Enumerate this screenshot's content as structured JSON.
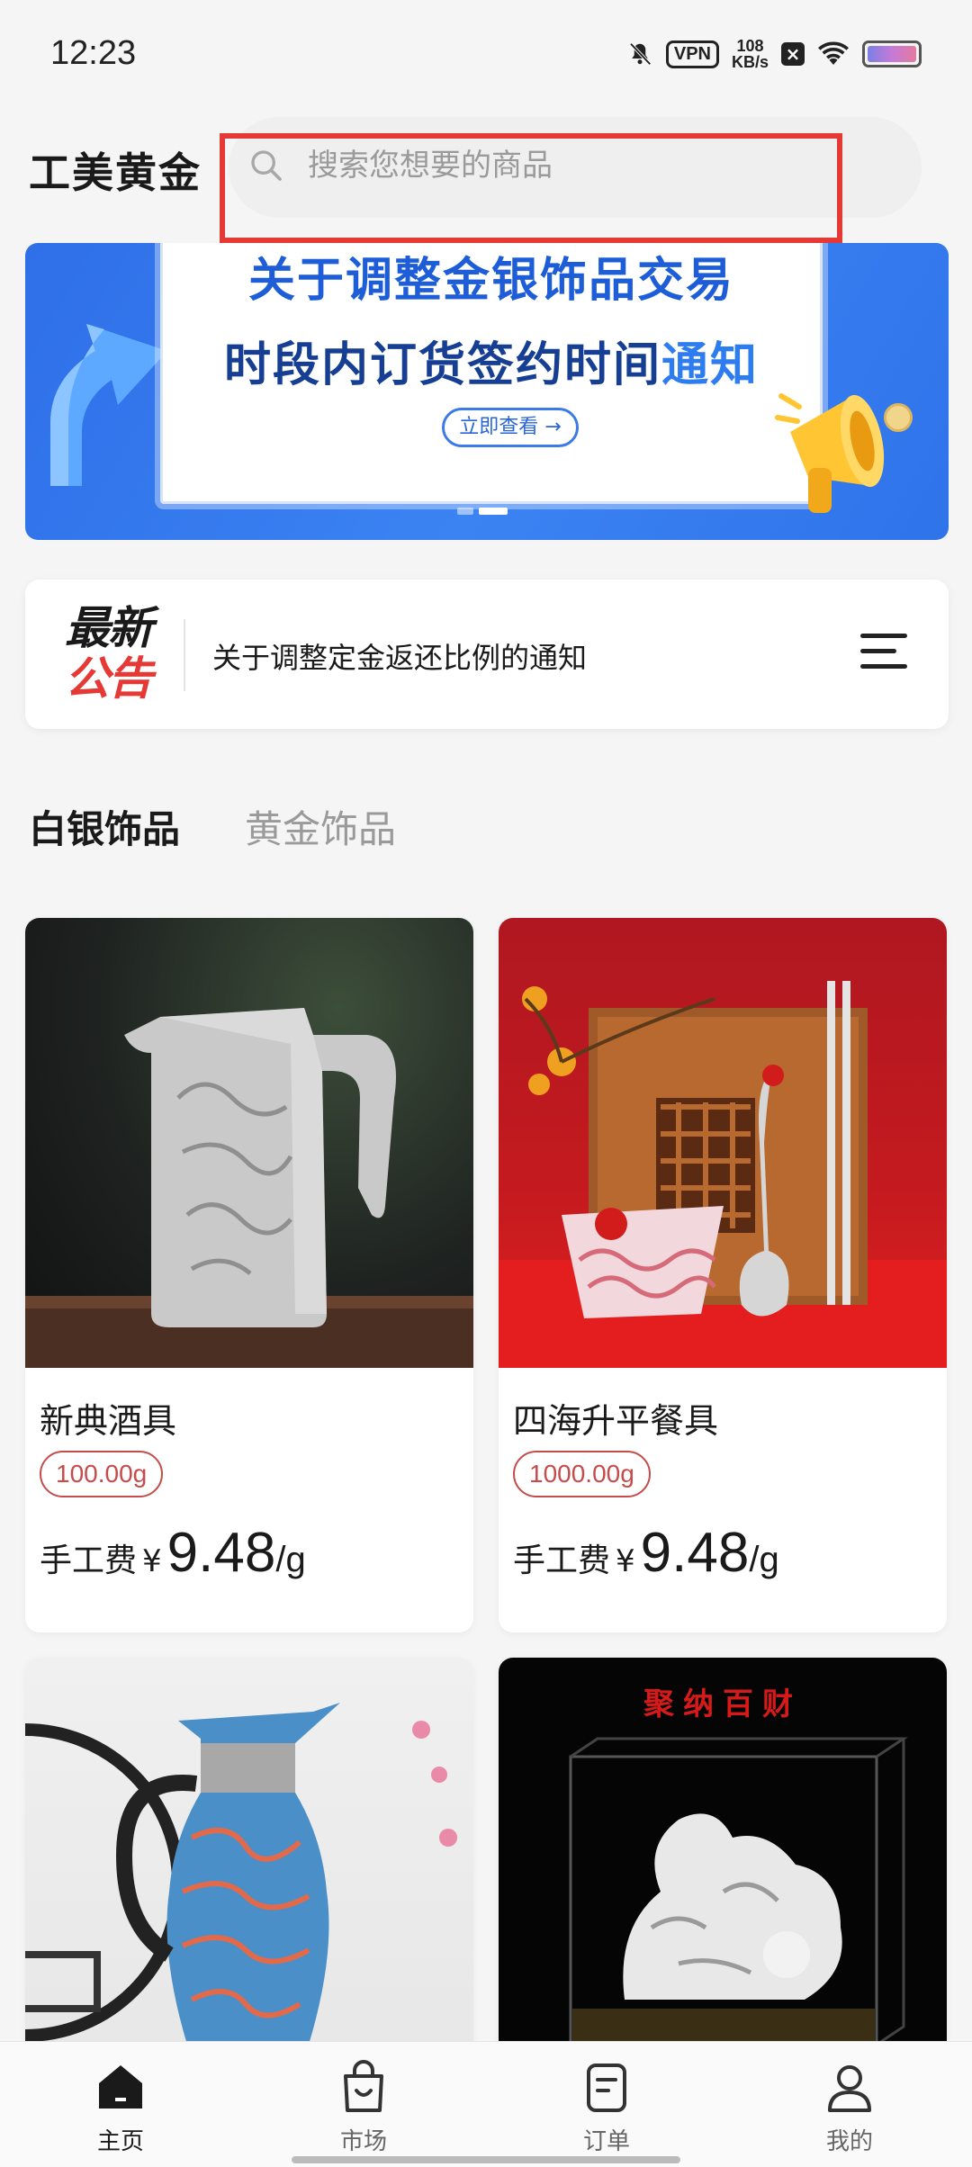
{
  "status_bar": {
    "time": "12:23",
    "vpn": "VPN",
    "speed_value": "108",
    "speed_unit": "KB/s",
    "icons": [
      "mute-bell-icon",
      "vpn-icon",
      "network-speed-icon",
      "close-notification-icon",
      "wifi-icon",
      "battery-icon"
    ]
  },
  "header": {
    "title": "工美黄金",
    "search_placeholder": "搜索您想要的商品"
  },
  "banner": {
    "line1": "关于调整金银饰品交易",
    "line2_main": "时段内订货签约时间",
    "line2_highlight": "通知",
    "button": "立即查看 →",
    "slide_count": 2,
    "active_slide": 2
  },
  "notice": {
    "badge_line1": "最新",
    "badge_line2": "公告",
    "text": "关于调整定金返还比例的通知"
  },
  "tabs": {
    "active": "白银饰品",
    "inactive": "黄金饰品"
  },
  "products": [
    {
      "name": "新典酒具",
      "weight": "100.00g",
      "price_label": "手工费",
      "currency": "¥",
      "price": "9.48",
      "unit": "/g"
    },
    {
      "name": "四海升平餐具",
      "weight": "1000.00g",
      "price_label": "手工费",
      "currency": "¥",
      "price": "9.48",
      "unit": "/g"
    },
    {
      "name": "",
      "image_text": ""
    },
    {
      "name": "",
      "image_text": "聚纳百财"
    }
  ],
  "bottom_nav": [
    {
      "label": "主页",
      "icon": "home-icon",
      "active": true
    },
    {
      "label": "市场",
      "icon": "shopping-bag-icon",
      "active": false
    },
    {
      "label": "订单",
      "icon": "document-icon",
      "active": false
    },
    {
      "label": "我的",
      "icon": "profile-icon",
      "active": false
    }
  ],
  "colors": {
    "accent_red": "#e53935",
    "banner_blue": "#2f6fe8",
    "weight_tag": "#c64b4b"
  }
}
